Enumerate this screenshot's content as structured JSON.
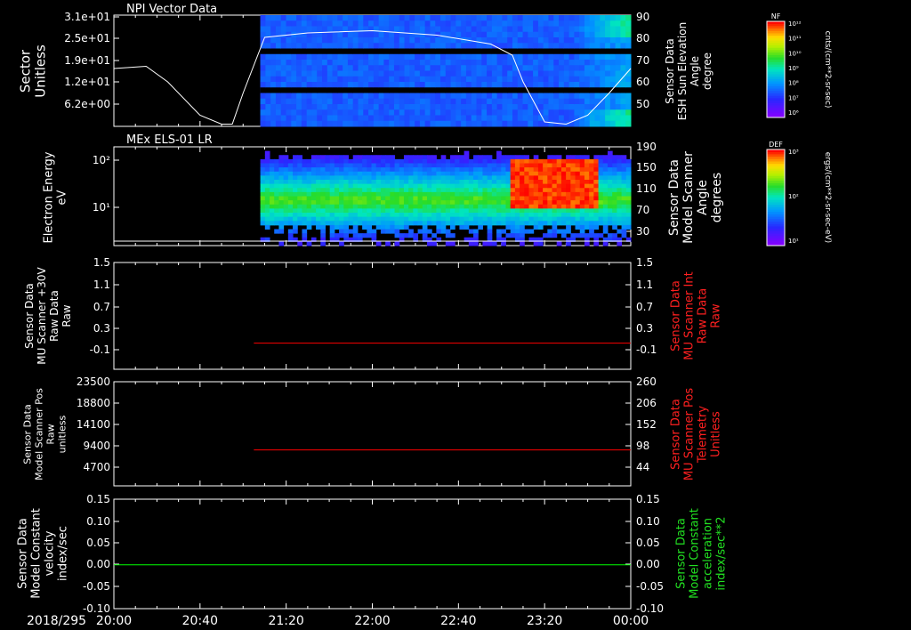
{
  "chart_data": [
    {
      "type": "heatmap",
      "title": "NPI Vector Data",
      "ylabel": "Sector Unitless",
      "y_ticks": [
        "3.1e+01",
        "2.5e+01",
        "1.9e+01",
        "1.2e+01",
        "6.2e+00"
      ],
      "y2label": [
        "Sensor Data",
        "ESH Sun Elevation",
        "Angle",
        "degree"
      ],
      "y2_ticks": [
        "90",
        "80",
        "70",
        "60",
        "50"
      ],
      "colorbar": {
        "label": "NF",
        "unit": "cnts/(cm**2-sr-sec)",
        "ticks": [
          "10¹²",
          "10¹¹",
          "10¹⁰",
          "10⁹",
          "10⁸",
          "10⁷",
          "10⁶"
        ]
      },
      "data_start": "21:08",
      "line": {
        "x": [
          "20:00",
          "20:15",
          "20:25",
          "20:40",
          "20:50",
          "20:55",
          "21:00",
          "21:10",
          "21:30",
          "22:00",
          "22:30",
          "22:55",
          "23:05",
          "23:10",
          "23:20",
          "23:30",
          "23:40",
          "23:50",
          "00:00"
        ],
        "y": [
          66,
          67,
          60,
          45,
          41,
          41,
          55,
          80,
          82,
          83,
          81,
          77,
          72,
          60,
          42,
          41,
          45,
          55,
          66
        ]
      }
    },
    {
      "type": "heatmap",
      "title": "MEx ELS-01 LR",
      "ylabel": [
        "Electron Energy",
        "eV"
      ],
      "y_ticks": [
        "10²",
        "10¹"
      ],
      "y2label": [
        "Sensor Data",
        "Model Scanner",
        "Angle",
        "degrees"
      ],
      "y2_ticks": [
        "190",
        "150",
        "110",
        "70",
        "30"
      ],
      "colorbar": {
        "label": "DEF",
        "unit": "ergs/(cm**2-sr-sec-eV)",
        "ticks": [
          "10³",
          "10²",
          "10¹"
        ]
      },
      "data_start": "21:08",
      "line": {
        "x": [
          "20:00",
          "00:00"
        ],
        "y": [
          18,
          18
        ]
      }
    },
    {
      "type": "line",
      "ylabel": [
        "Sensor Data",
        "MU Scanner +30V",
        "Raw Data",
        "Raw"
      ],
      "y_ticks": [
        "1.5",
        "1.1",
        "0.7",
        "0.3",
        "-0.1"
      ],
      "y2label": [
        "Sensor Data",
        "MU Scanner Int",
        "Raw Data",
        "Raw"
      ],
      "y2_ticks": [
        "1.5",
        "1.1",
        "0.7",
        "0.3",
        "-0.1"
      ],
      "ylim": [
        -0.5,
        1.5
      ],
      "series": [
        {
          "x": [
            "21:05",
            "00:00"
          ],
          "y": [
            -0.01,
            -0.01
          ],
          "color": "#ff0000"
        }
      ]
    },
    {
      "type": "line",
      "ylabel": [
        "Sensor Data",
        "Model Scanner Pos",
        "Raw",
        "unitless"
      ],
      "y_ticks": [
        "23500",
        "18800",
        "14100",
        "9400",
        "4700"
      ],
      "y2label": [
        "Sensor Data",
        "MU Scanner Pos",
        "Telemetry",
        "Unitless"
      ],
      "y2_ticks": [
        "260",
        "206",
        "152",
        "98",
        "44"
      ],
      "ylim": [
        0,
        23500
      ],
      "series": [
        {
          "x": [
            "21:05",
            "00:00"
          ],
          "y": [
            8100,
            8100
          ],
          "color": "#ff0000"
        }
      ]
    },
    {
      "type": "line",
      "ylabel": [
        "Sensor Data",
        "Model Constant",
        "velocity",
        "index/sec"
      ],
      "y_ticks": [
        "0.15",
        "0.10",
        "0.05",
        "0.00",
        "-0.05",
        "-0.10"
      ],
      "y2label": [
        "Sensor Data",
        "Model Constant",
        "acceleration",
        "index/sec**2"
      ],
      "y2_ticks": [
        "0.15",
        "0.10",
        "0.05",
        "0.00",
        "-0.05",
        "-0.10"
      ],
      "ylim": [
        -0.1,
        0.15
      ],
      "series": [
        {
          "x": [
            "20:00",
            "00:00"
          ],
          "y": [
            0,
            0
          ],
          "color": "#00ff00"
        }
      ]
    }
  ],
  "x_axis": {
    "date": "2018/295",
    "ticks": [
      "20:00",
      "20:40",
      "21:20",
      "22:00",
      "22:40",
      "23:20",
      "00:00"
    ]
  }
}
